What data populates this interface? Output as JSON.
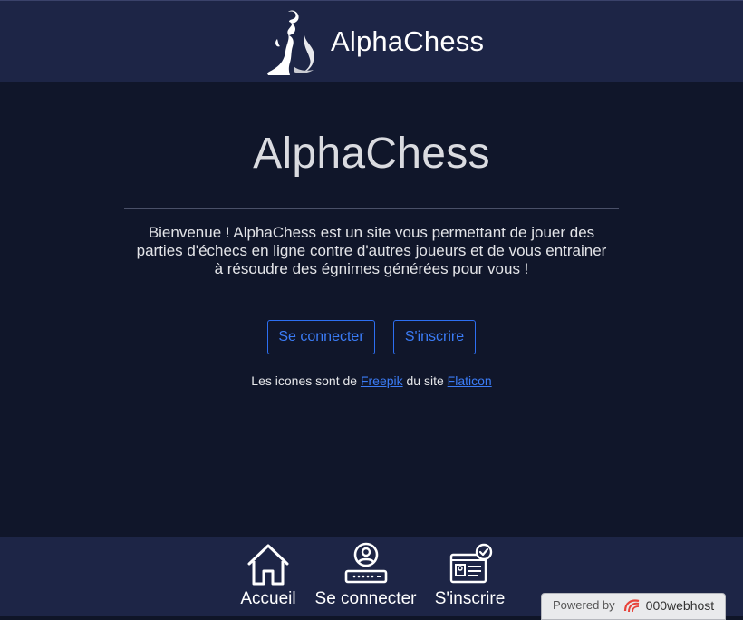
{
  "header": {
    "site_name": "AlphaChess",
    "logo_icon": "chess-queen-silhouette-icon"
  },
  "main": {
    "title": "AlphaChess",
    "intro_lines": [
      "Bienvenue ! AlphaChess est un site vous permettant de jouer des",
      "parties d'échecs en ligne contre d'autres joueurs et de vous entrainer",
      "à résoudre des égnimes générées pour vous !"
    ],
    "buttons": {
      "login_label": "Se connecter",
      "signup_label": "S'inscrire"
    },
    "credits": {
      "prefix": "Les icones sont de",
      "author_link": "Freepik",
      "middle": "du site",
      "site_link": "Flaticon"
    }
  },
  "bottom_nav": {
    "items": [
      {
        "label": "Accueil",
        "icon": "home-icon"
      },
      {
        "label": "Se connecter",
        "icon": "user-login-icon"
      },
      {
        "label": "S'inscrire",
        "icon": "id-card-check-icon"
      }
    ]
  },
  "badge": {
    "powered_by": "Powered by",
    "host_name": "000webhost"
  },
  "colors": {
    "header_bg": "#1d2546",
    "main_bg": "#10162a",
    "accent": "#3b7cf6"
  }
}
